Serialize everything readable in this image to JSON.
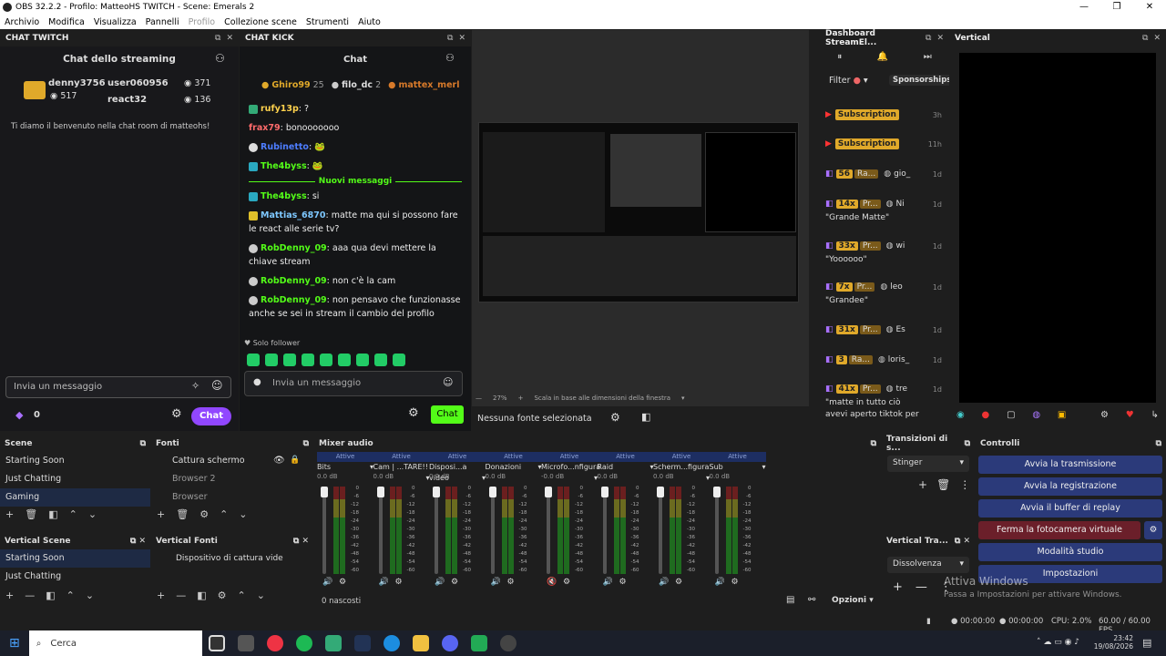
{
  "window": {
    "title": "OBS 32.2.2 - Profilo: MatteoHS TWITCH - Scene: Emerals 2",
    "controls": [
      "—",
      "❐",
      "✕"
    ]
  },
  "menu": [
    "Archivio",
    "Modifica",
    "Visualizza",
    "Pannelli",
    "Profilo",
    "Collezione scene",
    "Strumenti",
    "Aiuto"
  ],
  "twitch": {
    "dock_title": "CHAT TWITCH",
    "header": "Chat dello streaming",
    "u1": "denny3756",
    "u1c": "517",
    "u2": "user060956",
    "u2c": "371",
    "u3": "react32",
    "u3c": "136",
    "welcome": "Ti diamo il benvenuto nella chat room di matteohs!",
    "input_placeholder": "Invia un messaggio",
    "points": "0",
    "chat_btn": "Chat"
  },
  "kick": {
    "dock_title": "CHAT KICK",
    "header": "Chat",
    "top": [
      {
        "n": "Ghiro99",
        "c": "25"
      },
      {
        "n": "filo_dc",
        "c": "2"
      },
      {
        "n": "mattex_merl",
        "c": ""
      }
    ],
    "msgs": [
      {
        "u": "rufy13p",
        "t": "?",
        "col": "#ffd24d"
      },
      {
        "u": "frax79",
        "t": "bonooooooo",
        "col": "#ff6b6b"
      },
      {
        "u": "Rubinetto",
        "t": "",
        "col": "#4d7dff"
      },
      {
        "u": "The4byss",
        "t": "",
        "col": "#53fc18"
      }
    ],
    "new_label": "Nuovi messaggi",
    "msgs2": [
      {
        "u": "The4byss",
        "t": "si",
        "col": "#53fc18"
      },
      {
        "u": "Mattias_6870",
        "t": "matte ma qui si possono fare le react alle serie tv?",
        "col": "#7ec8ff"
      },
      {
        "u": "RobDenny_09",
        "t": "aaa qua devi mettere la chiave stream",
        "col": "#53fc18"
      },
      {
        "u": "RobDenny_09",
        "t": "non c'è la cam",
        "col": "#53fc18"
      },
      {
        "u": "RobDenny_09",
        "t": "non pensavo che funzionasse anche se sei in stream il cambio del profilo",
        "col": "#53fc18"
      }
    ],
    "follower": "♥ Solo follower",
    "input_placeholder": "Invia un messaggio",
    "chat_btn": "Chat"
  },
  "preview": {
    "zoom": "27%",
    "scale": "Scala in base alle dimensioni della finestra",
    "no_source": "Nessuna fonte selezionata"
  },
  "dashboard": {
    "dock_title": "Dashboard StreamEl...",
    "filter": "Filter",
    "sponsor": "Sponsorships",
    "rows": [
      {
        "tag": "Subscription",
        "name": "",
        "time": "3h",
        "kind": "yt"
      },
      {
        "tag": "Subscription",
        "name": "",
        "time": "11h",
        "kind": "yt"
      },
      {
        "tag": "56",
        "ex": "Ra...",
        "name": "gio_",
        "time": "1d",
        "kind": "tw"
      },
      {
        "tag": "14x",
        "ex": "Pr...",
        "name": "Ni",
        "time": "1d",
        "kind": "tw",
        "note": "\"Grande Matte\""
      },
      {
        "tag": "33x",
        "ex": "Pr...",
        "name": "wi",
        "time": "1d",
        "kind": "tw",
        "note": "\"Yoooooo\""
      },
      {
        "tag": "7x",
        "ex": "Pr...",
        "name": "leo",
        "time": "1d",
        "kind": "tw",
        "note": "\"Grandee\""
      },
      {
        "tag": "31x",
        "ex": "Pr...",
        "name": "Es",
        "time": "1d",
        "kind": "tw"
      },
      {
        "tag": "3",
        "ex": "Ra...",
        "name": "loris_",
        "time": "1d",
        "kind": "tw"
      },
      {
        "tag": "41x",
        "ex": "Pr...",
        "name": "tre",
        "time": "1d",
        "kind": "tw",
        "note": "\"matte in tutto ciò avevi aperto tiktok per"
      }
    ]
  },
  "vertical": {
    "dock_title": "Vertical"
  },
  "scenes": {
    "title": "Scene",
    "items": [
      "Starting Soon",
      "Just Chatting",
      "Gaming"
    ],
    "selected": 2
  },
  "sources": {
    "title": "Fonti",
    "items": [
      "Cattura schermo",
      "Browser 2",
      "Browser"
    ]
  },
  "vscenes": {
    "title": "Vertical Scene",
    "items": [
      "Starting Soon",
      "Just Chatting"
    ]
  },
  "vsources": {
    "title": "Vertical Fonti",
    "items": [
      "Dispositivo di cattura vide"
    ]
  },
  "mixer": {
    "title": "Mixer audio",
    "hidden": "0 nascosti",
    "options": "Opzioni",
    "channels": [
      {
        "n": "Bits",
        "db": "0.0 dB",
        "act": "Attive"
      },
      {
        "n": "Cam | ...TARE!!",
        "db": "0.0 dB",
        "act": "Attive"
      },
      {
        "n": "Disposi...a video",
        "db": "0.0 dB",
        "act": "Attive"
      },
      {
        "n": "Donazioni",
        "db": "0.0 dB",
        "act": "Attive"
      },
      {
        "n": "Microfo...nfigura",
        "db": "-0.0 dB",
        "act": "Attive"
      },
      {
        "n": "Raid",
        "db": "0.0 dB",
        "act": "Attive"
      },
      {
        "n": "Scherm...figura",
        "db": "0.0 dB",
        "act": "Attive"
      },
      {
        "n": "Sub",
        "db": "0.0 dB",
        "act": "Attive"
      }
    ],
    "scale": [
      "0",
      "-6",
      "-12",
      "-18",
      "-24",
      "-30",
      "-36",
      "-42",
      "-48",
      "-54",
      "-60"
    ]
  },
  "transitions": {
    "title": "Transizioni di s...",
    "value": "Stinger"
  },
  "vtransitions": {
    "title": "Vertical Tra...",
    "value": "Dissolvenza"
  },
  "controls": {
    "title": "Controlli",
    "b1": "Avvia la trasmissione",
    "b2": "Avvia la registrazione",
    "b3": "Avvia il buffer di replay",
    "b4": "Ferma la fotocamera virtuale",
    "b5": "Modalità studio",
    "b6": "Impostazioni"
  },
  "watermark": {
    "l1": "Attiva Windows",
    "l2": "Passa a Impostazioni per attivare Windows."
  },
  "status": {
    "t1": "00:00:00",
    "t2": "00:00:00",
    "cpu": "CPU: 2.0%",
    "fps": "60.00 / 60.00 FPS"
  },
  "taskbar": {
    "search": "Cerca",
    "time": "23:42",
    "date": "19/08/2026"
  },
  "colors": {
    "twitch": "#9147ff",
    "kick": "#53fc18",
    "control": "#2b3a7a"
  }
}
